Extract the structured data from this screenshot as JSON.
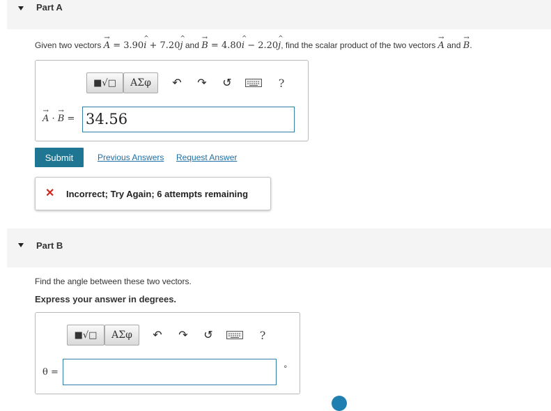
{
  "part_a": {
    "title": "Part A",
    "statement": {
      "prefix": "Given two vectors ",
      "vec_a": "A",
      "eq": " = 3.90",
      "plus": " + 7.20",
      "and_b": " and ",
      "vec_b": "B",
      "eq_b": " = 4.80",
      "minus": " − 2.20",
      "suffix": ", find the scalar product of the two vectors ",
      "and_word": " and ",
      "period": ".",
      "i": "i",
      "j": "j"
    },
    "toolbar": {
      "templates_label": "■√□",
      "symbols_label": "ΑΣφ",
      "undo_glyph": "↶",
      "redo_glyph": "↷",
      "reset_glyph": "↺",
      "help_label": "?"
    },
    "answer_label_dot": " · ",
    "answer_label_eq": " =",
    "answer_value": "34.56",
    "submit_label": "Submit",
    "previous_answers": "Previous Answers",
    "request_answer": "Request Answer",
    "feedback_text": "Incorrect; Try Again; 6 attempts remaining"
  },
  "part_b": {
    "title": "Part B",
    "question": "Find the angle between these two vectors.",
    "instruction": "Express your answer in degrees.",
    "toolbar": {
      "templates_label": "■√□",
      "symbols_label": "ΑΣφ",
      "undo_glyph": "↶",
      "redo_glyph": "↷",
      "reset_glyph": "↺",
      "help_label": "?"
    },
    "answer_label": "θ =",
    "answer_value": "",
    "unit": "°"
  }
}
